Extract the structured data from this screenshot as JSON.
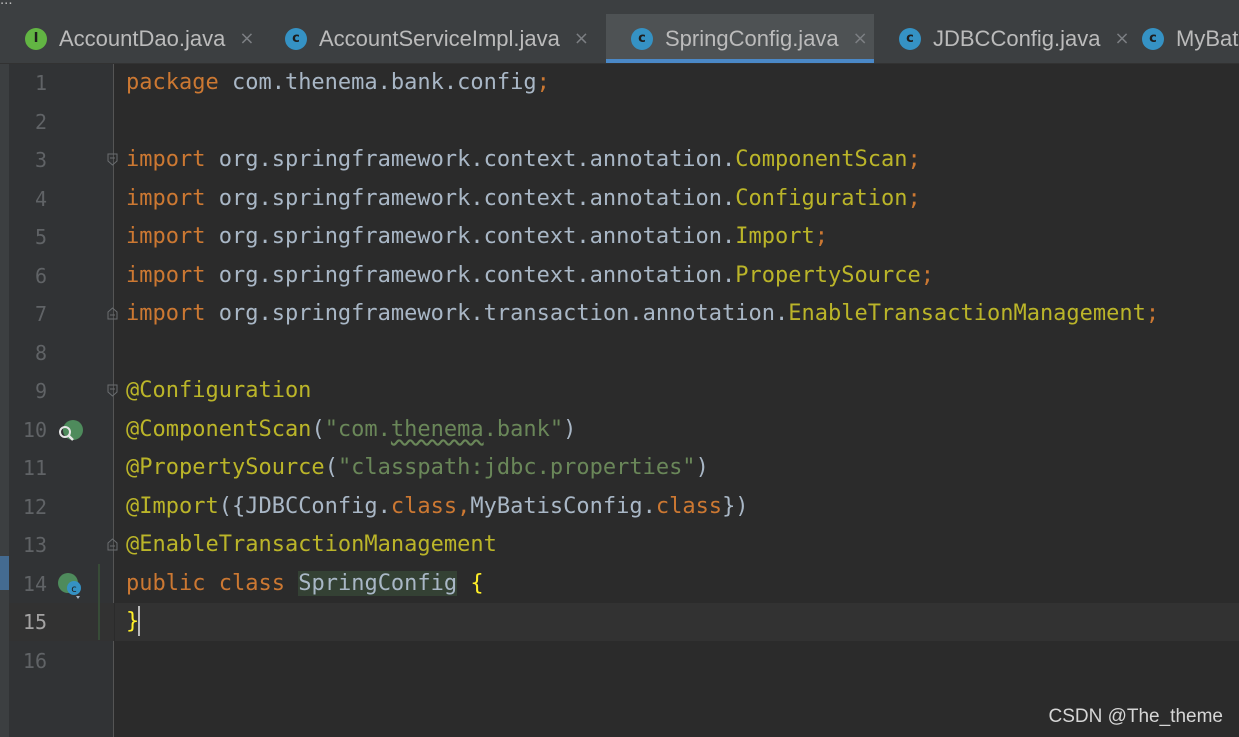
{
  "window": {
    "title_fragment": "..."
  },
  "tabs": [
    {
      "label": "AccountDao.java",
      "icon": "interface-file-icon",
      "icon_letter": "I",
      "close": "×",
      "active": false
    },
    {
      "label": "AccountServiceImpl.java",
      "icon": "class-file-icon",
      "icon_letter": "c",
      "close": "×",
      "active": false
    },
    {
      "label": "SpringConfig.java",
      "icon": "class-file-icon",
      "icon_letter": "c",
      "close": "×",
      "active": true
    },
    {
      "label": "JDBCConfig.java",
      "icon": "class-file-icon",
      "icon_letter": "c",
      "close": "×",
      "active": false
    },
    {
      "label": "MyBatisConfig.java",
      "icon": "class-file-icon",
      "icon_letter": "c",
      "close": "×",
      "active": false
    }
  ],
  "editor": {
    "current_line": 15,
    "line_numbers": [
      "1",
      "2",
      "3",
      "4",
      "5",
      "6",
      "7",
      "8",
      "9",
      "10",
      "11",
      "12",
      "13",
      "14",
      "15",
      "16"
    ],
    "lines": [
      [
        {
          "t": "package",
          "c": "kw"
        },
        {
          "t": " com.thenema.bank.config"
        },
        {
          "t": ";",
          "c": "kw"
        }
      ],
      [],
      [
        {
          "t": "import",
          "c": "kw"
        },
        {
          "t": " org.springframework.context.annotation."
        },
        {
          "t": "ComponentScan",
          "c": "ann"
        },
        {
          "t": ";",
          "c": "kw"
        }
      ],
      [
        {
          "t": "import",
          "c": "kw"
        },
        {
          "t": " org.springframework.context.annotation."
        },
        {
          "t": "Configuration",
          "c": "ann"
        },
        {
          "t": ";",
          "c": "kw"
        }
      ],
      [
        {
          "t": "import",
          "c": "kw"
        },
        {
          "t": " org.springframework.context.annotation."
        },
        {
          "t": "Import",
          "c": "ann"
        },
        {
          "t": ";",
          "c": "kw"
        }
      ],
      [
        {
          "t": "import",
          "c": "kw"
        },
        {
          "t": " org.springframework.context.annotation."
        },
        {
          "t": "PropertySource",
          "c": "ann"
        },
        {
          "t": ";",
          "c": "kw"
        }
      ],
      [
        {
          "t": "import",
          "c": "kw"
        },
        {
          "t": " org.springframework.transaction.annotation."
        },
        {
          "t": "EnableTransactionManagement",
          "c": "ann"
        },
        {
          "t": ";",
          "c": "kw"
        }
      ],
      [],
      [
        {
          "t": "@Configuration",
          "c": "ann"
        }
      ],
      [
        {
          "t": "@ComponentScan",
          "c": "ann"
        },
        {
          "t": "("
        },
        {
          "t": "\"com.",
          "c": "str"
        },
        {
          "t": "thenema",
          "c": "str wavy"
        },
        {
          "t": ".bank\"",
          "c": "str"
        },
        {
          "t": ")"
        }
      ],
      [
        {
          "t": "@PropertySource",
          "c": "ann"
        },
        {
          "t": "("
        },
        {
          "t": "\"classpath:jdbc.properties\"",
          "c": "str"
        },
        {
          "t": ")"
        }
      ],
      [
        {
          "t": "@Import",
          "c": "ann"
        },
        {
          "t": "({JDBCConfig."
        },
        {
          "t": "class",
          "c": "kw"
        },
        {
          "t": ",",
          "c": "kw"
        },
        {
          "t": "MyBatisConfig."
        },
        {
          "t": "class",
          "c": "kw"
        },
        {
          "t": "})"
        }
      ],
      [
        {
          "t": "@EnableTransactionManagement",
          "c": "ann"
        }
      ],
      [
        {
          "t": "public",
          "c": "kw"
        },
        {
          "t": " "
        },
        {
          "t": "class",
          "c": "kw"
        },
        {
          "t": " "
        },
        {
          "t": "SpringConfig",
          "c": "cls-hl"
        },
        {
          "t": " "
        },
        {
          "t": "{",
          "c": "brace"
        }
      ],
      [
        {
          "t": "}",
          "c": "brace"
        }
      ],
      []
    ]
  },
  "gutter_icons": [
    {
      "line": 10,
      "icon": "bean-scan-icon"
    },
    {
      "line": 14,
      "icon": "spring-bean-class-icon"
    }
  ],
  "watermark": "CSDN @The_theme",
  "colors": {
    "background": "#2b2b2b",
    "keyword": "#cc7832",
    "annotation": "#bbb529",
    "string": "#6a8759",
    "text": "#a9b7c6",
    "tab_accent": "#4a88c7"
  }
}
